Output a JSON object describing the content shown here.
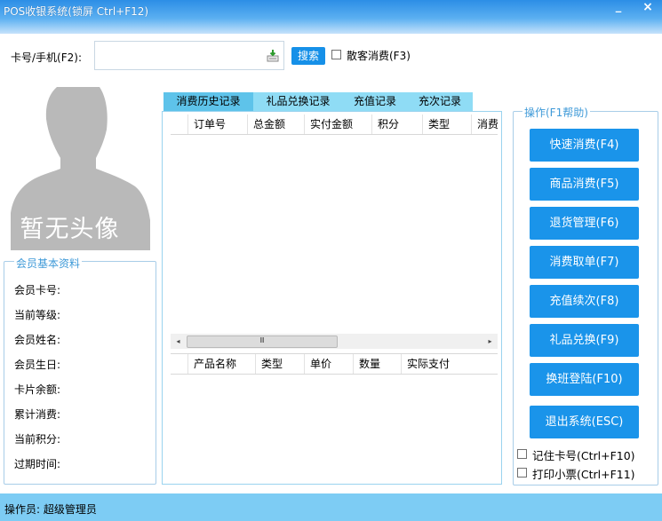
{
  "window": {
    "title": "POS收银系统(锁屏 Ctrl+F12)",
    "min_glyph": "_",
    "close_glyph": "×"
  },
  "member_search": {
    "label": "卡号/手机(F2):",
    "input_value": "",
    "search_button": "搜索",
    "walkin_label": "散客消费(F3)",
    "walkin_checked": false
  },
  "avatar": {
    "text": "暂无头像"
  },
  "member_info": {
    "title": "会员基本资料",
    "fields": [
      {
        "label": "会员卡号:",
        "value": ""
      },
      {
        "label": "当前等级:",
        "value": ""
      },
      {
        "label": "会员姓名:",
        "value": ""
      },
      {
        "label": "会员生日:",
        "value": ""
      },
      {
        "label": "卡片余额:",
        "value": ""
      },
      {
        "label": "累计消费:",
        "value": ""
      },
      {
        "label": "当前积分:",
        "value": ""
      },
      {
        "label": "过期时间:",
        "value": ""
      }
    ]
  },
  "tabs": [
    {
      "label": "消费历史记录",
      "active": true
    },
    {
      "label": "礼品兑换记录",
      "active": false
    },
    {
      "label": "充值记录",
      "active": false
    },
    {
      "label": "充次记录",
      "active": false
    }
  ],
  "orders_grid": {
    "columns": [
      "订单号",
      "总金额",
      "实付金额",
      "积分",
      "类型",
      "消费"
    ]
  },
  "scrollbar": {
    "left": "◂",
    "right": "▸",
    "grip": "Ⅲ"
  },
  "products_grid": {
    "columns": [
      "产品名称",
      "类型",
      "单价",
      "数量",
      "实际支付"
    ]
  },
  "operations": {
    "title": "操作(F1帮助)",
    "buttons": [
      "快速消费(F4)",
      "商品消费(F5)",
      "退货管理(F6)",
      "消费取单(F7)",
      "充值续次(F8)",
      "礼品兑换(F9)",
      "换班登陆(F10)",
      "退出系统(ESC)"
    ],
    "remember_card": "记住卡号(Ctrl+F10)",
    "print_receipt": "打印小票(Ctrl+F11)"
  },
  "status": {
    "text": "操作员: 超级管理员"
  },
  "colors": {
    "accent": "#1a94ea",
    "title_bar": "#2c8ee6",
    "status_bar": "#7dccf4",
    "tab": "#8fdcf5",
    "tab_active": "#5ec3ea"
  }
}
